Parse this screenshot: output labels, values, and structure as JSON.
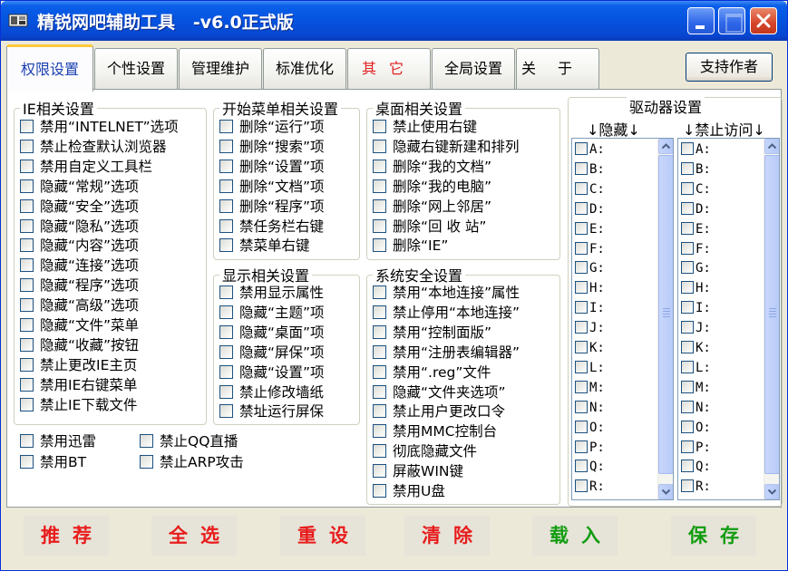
{
  "window": {
    "title": "精锐网吧辅助工具   -v6.0正式版"
  },
  "tabs": [
    {
      "label": "权限设置",
      "active": true
    },
    {
      "label": "个性设置"
    },
    {
      "label": "管理维护"
    },
    {
      "label": "标准优化"
    },
    {
      "label": "其它"
    },
    {
      "label": "全局设置"
    },
    {
      "label": "关于"
    }
  ],
  "support_button": "支持作者",
  "groups": {
    "ie": {
      "legend": "IE相关设置",
      "items": [
        "禁用“INTELNET”选项",
        "禁止检查默认浏览器",
        "禁用自定义工具栏",
        "隐藏“常规”选项",
        "隐藏“安全”选项",
        "隐藏“隐私”选项",
        "隐藏“内容”选项",
        "隐藏“连接”选项",
        "隐藏“程序”选项",
        "隐藏“高级”选项",
        "隐藏“文件”菜单",
        "隐藏“收藏”按钮",
        "禁止更改IE主页",
        "禁用IE右键菜单",
        "禁止IE下载文件"
      ]
    },
    "loose": [
      "禁用迅雷",
      "禁用BT",
      "禁止QQ直播",
      "禁止ARP攻击"
    ],
    "start_menu": {
      "legend": "开始菜单相关设置",
      "items": [
        "删除“运行”项",
        "删除“搜索”项",
        "删除“设置”项",
        "删除“文档”项",
        "删除“程序”项",
        "禁任务栏右键",
        "禁菜单右键"
      ]
    },
    "display": {
      "legend": "显示相关设置",
      "items": [
        "禁用显示属性",
        "隐藏“主题”项",
        "隐藏“桌面”项",
        "隐藏“屏保”项",
        "隐藏“设置”项",
        "禁止修改墙纸",
        "禁址运行屏保"
      ]
    },
    "desktop": {
      "legend": "桌面相关设置",
      "items": [
        "禁止使用右键",
        "隐藏右键新建和排列",
        "删除“我的文档”",
        "删除“我的电脑”",
        "删除“网上邻居”",
        "删除“回 收 站”",
        "删除“IE”"
      ]
    },
    "security": {
      "legend": "系统安全设置",
      "items": [
        "禁用“本地连接”属性",
        "禁止停用“本地连接”",
        "禁用“控制面版”",
        "禁用“注册表编辑器”",
        "禁用“.reg”文件",
        "隐藏“文件夹选项”",
        "禁止用户更改口令",
        "禁用MMC控制台",
        "彻底隐藏文件",
        "屏蔽WIN键",
        "禁用U盘"
      ]
    }
  },
  "drives": {
    "title": "驱动器设置",
    "hide_header": "↓隐藏↓",
    "deny_header": "↓禁止访问↓",
    "letters": [
      "A:",
      "B:",
      "C:",
      "D:",
      "E:",
      "F:",
      "G:",
      "H:",
      "I:",
      "J:",
      "K:",
      "L:",
      "M:",
      "N:",
      "O:",
      "P:",
      "Q:",
      "R:"
    ]
  },
  "bottom_buttons": [
    {
      "label": "推荐",
      "color": "#e81c1c"
    },
    {
      "label": "全选",
      "color": "#e81c1c"
    },
    {
      "label": "重设",
      "color": "#e81c1c"
    },
    {
      "label": "清除",
      "color": "#e81c1c"
    },
    {
      "label": "载入",
      "color": "#129c10"
    },
    {
      "label": "保存",
      "color": "#129c10"
    }
  ]
}
